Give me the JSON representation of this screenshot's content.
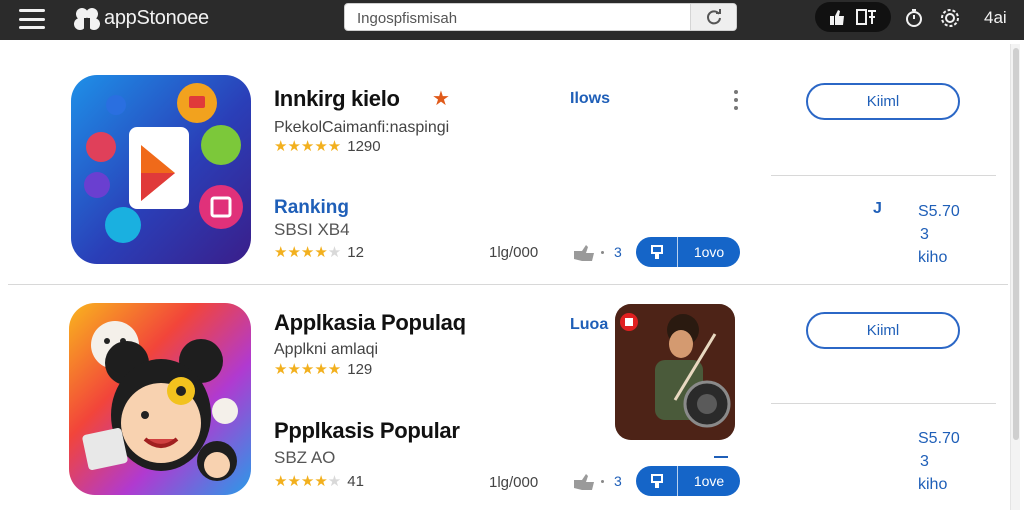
{
  "header": {
    "app_name": "appStonoee",
    "search_value": "Ingospfismisah",
    "right_count": "4ai"
  },
  "colors": {
    "topbar": "#2b2b2b",
    "accent": "#1565c8",
    "star": "#f2b01e"
  },
  "listing1": {
    "title": "Innkirg kielo",
    "subtitle": "PkekolCaimanfi:naspingi",
    "rating_count": "1290",
    "stars": 5,
    "tag_label": "Ilows",
    "install_label": "Kiiml",
    "rank_label": "Ranking",
    "rank_code": "SBSI XB4",
    "rank_rating_count": "12",
    "rank_stars": 3.5,
    "downloads": "1lg/000",
    "share_count": "3",
    "action_label": "1ovo",
    "price_note": "J",
    "price_lines": [
      "S5.70",
      "3",
      "kiho"
    ]
  },
  "listing2": {
    "title": "Applkasia Populaq",
    "subtitle": "Applkni amlaqi",
    "rating_count": "129",
    "stars": 5,
    "tag_label": "Luoa",
    "install_label": "Kiiml",
    "second_title": "Ppplkasis Popular",
    "second_code": "SBZ AO",
    "second_rating_count": "41",
    "second_stars": 4.5,
    "downloads": "1lg/000",
    "share_count": "3",
    "action_label": "1ove",
    "price_lines": [
      "S5.70",
      "3",
      "kiho"
    ]
  }
}
